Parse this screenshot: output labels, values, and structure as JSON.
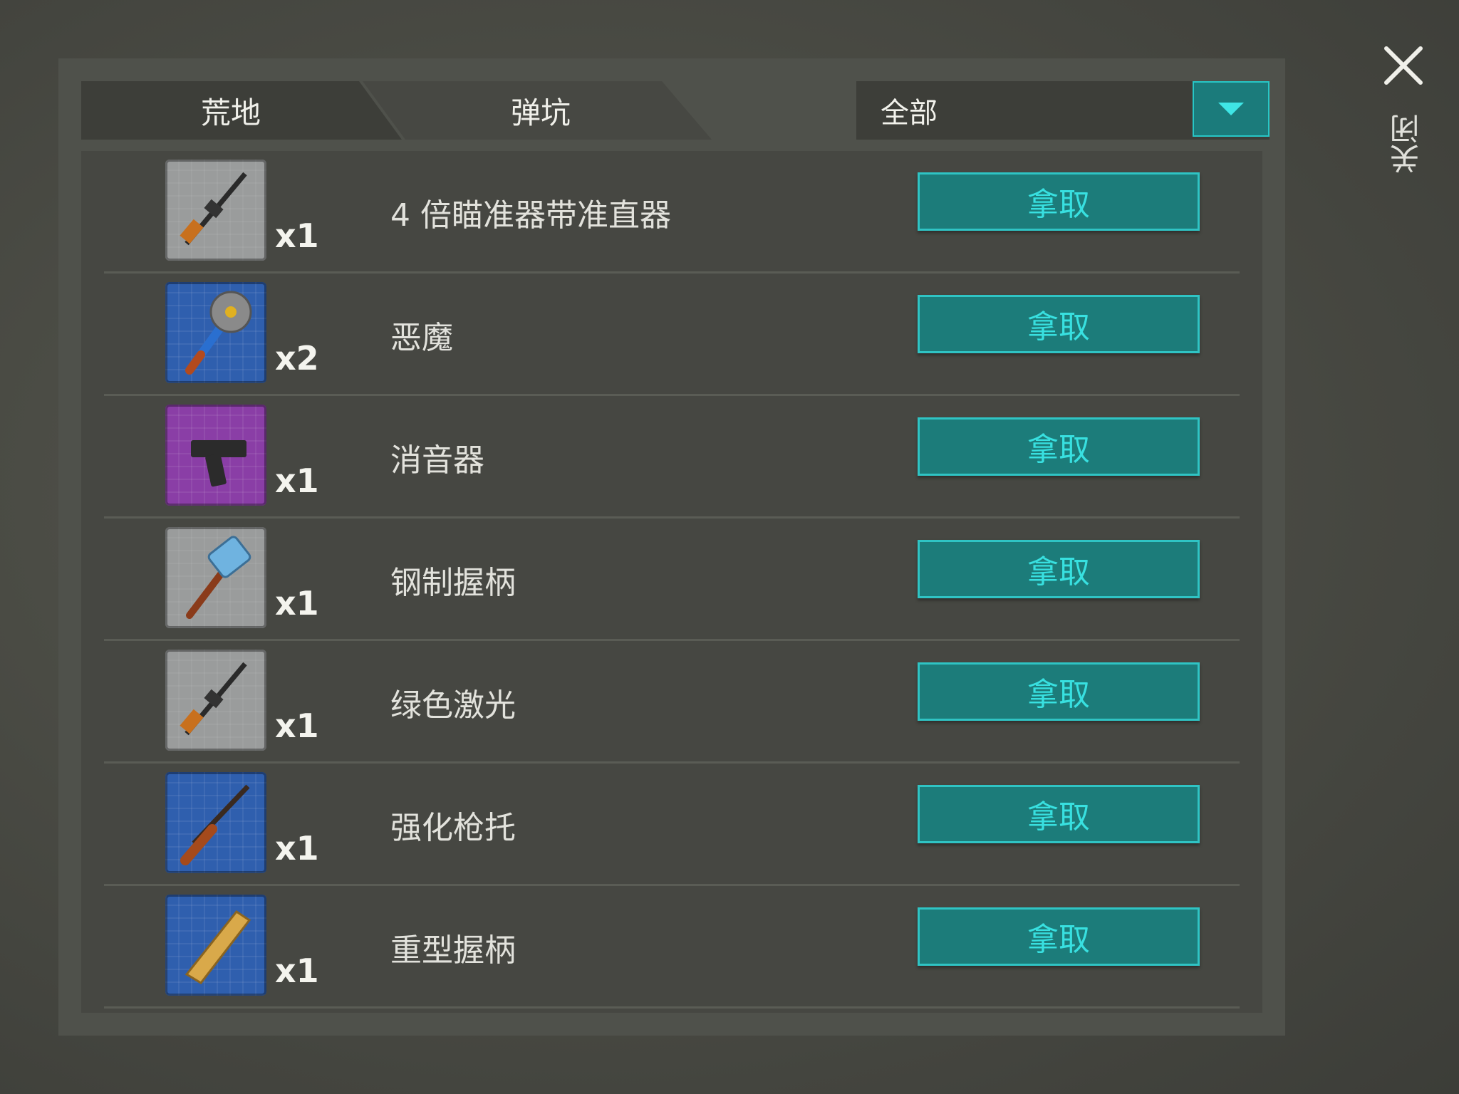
{
  "tabs": [
    "荒地",
    "弹坑"
  ],
  "filter": {
    "selected": "全部"
  },
  "close_label": "关闭",
  "take_label": "拿取",
  "items": [
    {
      "name": "4 倍瞄准器带准直器",
      "qty": "x1",
      "icon": "rifle-blueprint-icon",
      "tier_color": "gray"
    },
    {
      "name": "恶魔",
      "qty": "x2",
      "icon": "sawblade-mace-blueprint-icon",
      "tier_color": "blue"
    },
    {
      "name": "消音器",
      "qty": "x1",
      "icon": "pistol-blueprint-icon",
      "tier_color": "purple"
    },
    {
      "name": "钢制握柄",
      "qty": "x1",
      "icon": "hammer-blueprint-icon",
      "tier_color": "gray"
    },
    {
      "name": "绿色激光",
      "qty": "x1",
      "icon": "rifle-blueprint-icon",
      "tier_color": "gray"
    },
    {
      "name": "强化枪托",
      "qty": "x1",
      "icon": "shotgun-blueprint-icon",
      "tier_color": "blue"
    },
    {
      "name": "重型握柄",
      "qty": "x1",
      "icon": "wooden-plank-blueprint-icon",
      "tier_color": "blue"
    }
  ]
}
